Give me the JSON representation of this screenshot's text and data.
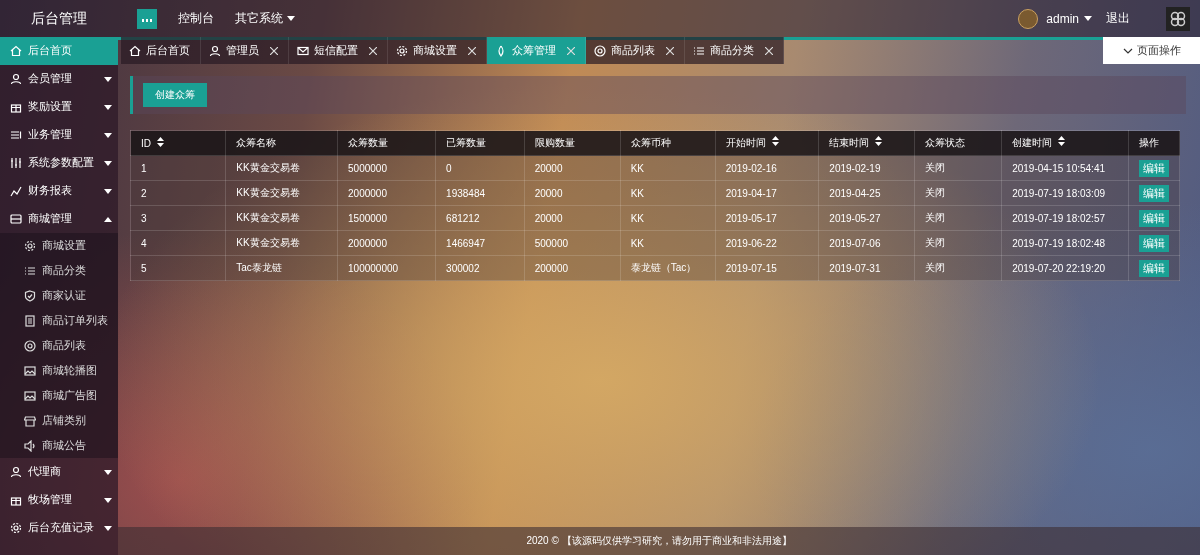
{
  "header": {
    "title": "后台管理",
    "nav": [
      {
        "label": "控制台",
        "dropdown": false
      },
      {
        "label": "其它系统",
        "dropdown": true
      }
    ],
    "user": "admin",
    "logout": "退出"
  },
  "sidebar": {
    "items": [
      {
        "label": "后台首页",
        "selected": true,
        "expanded": false
      },
      {
        "label": "会员管理",
        "selected": false,
        "expanded": false
      },
      {
        "label": "奖励设置",
        "selected": false,
        "expanded": false
      },
      {
        "label": "业务管理",
        "selected": false,
        "expanded": false
      },
      {
        "label": "系统参数配置",
        "selected": false,
        "expanded": false
      },
      {
        "label": "财务报表",
        "selected": false,
        "expanded": false
      },
      {
        "label": "商城管理",
        "selected": false,
        "expanded": true,
        "children": [
          {
            "label": "商城设置",
            "selected": false
          },
          {
            "label": "商品分类",
            "selected": false
          },
          {
            "label": "商家认证",
            "selected": false
          },
          {
            "label": "商品订单列表",
            "selected": false
          },
          {
            "label": "商品列表",
            "selected": false
          },
          {
            "label": "商城轮播图",
            "selected": false
          },
          {
            "label": "商城广告图",
            "selected": false
          },
          {
            "label": "店铺类别",
            "selected": false
          },
          {
            "label": "商城公告",
            "selected": false
          }
        ]
      },
      {
        "label": "代理商",
        "selected": false,
        "expanded": false
      },
      {
        "label": "牧场管理",
        "selected": false,
        "expanded": false
      },
      {
        "label": "后台充值记录",
        "selected": false,
        "expanded": false
      }
    ]
  },
  "tabs": [
    {
      "label": "后台首页",
      "selected": false,
      "closable": false
    },
    {
      "label": "管理员",
      "selected": false,
      "closable": true
    },
    {
      "label": "短信配置",
      "selected": false,
      "closable": true
    },
    {
      "label": "商城设置",
      "selected": false,
      "closable": true
    },
    {
      "label": "众筹管理",
      "selected": true,
      "closable": true
    },
    {
      "label": "商品列表",
      "selected": false,
      "closable": true
    },
    {
      "label": "商品分类",
      "selected": false,
      "closable": true
    }
  ],
  "page_actions": "页面操作",
  "create_button": "创建众筹",
  "table": {
    "columns": [
      {
        "label": "ID",
        "sortable": true
      },
      {
        "label": "众筹名称",
        "sortable": false
      },
      {
        "label": "众筹数量",
        "sortable": false
      },
      {
        "label": "已筹数量",
        "sortable": false
      },
      {
        "label": "限购数量",
        "sortable": false
      },
      {
        "label": "众筹币种",
        "sortable": false
      },
      {
        "label": "开始时间",
        "sortable": true
      },
      {
        "label": "结束时间",
        "sortable": true
      },
      {
        "label": "众筹状态",
        "sortable": false
      },
      {
        "label": "创建时间",
        "sortable": true
      },
      {
        "label": "操作",
        "sortable": false
      }
    ],
    "rows": [
      {
        "cells": [
          "1",
          "KK黄金交易卷",
          "5000000",
          "0",
          "20000",
          "KK",
          "2019-02-16",
          "2019-02-19",
          "关闭",
          "2019-04-15 10:54:41"
        ],
        "action": "编辑"
      },
      {
        "cells": [
          "2",
          "KK黄金交易卷",
          "2000000",
          "1938484",
          "20000",
          "KK",
          "2019-04-17",
          "2019-04-25",
          "关闭",
          "2019-07-19 18:03:09"
        ],
        "action": "编辑"
      },
      {
        "cells": [
          "3",
          "KK黄金交易卷",
          "1500000",
          "681212",
          "20000",
          "KK",
          "2019-05-17",
          "2019-05-27",
          "关闭",
          "2019-07-19 18:02:57"
        ],
        "action": "编辑"
      },
      {
        "cells": [
          "4",
          "KK黄金交易卷",
          "2000000",
          "1466947",
          "500000",
          "KK",
          "2019-06-22",
          "2019-07-06",
          "关闭",
          "2019-07-19 18:02:48"
        ],
        "action": "编辑"
      },
      {
        "cells": [
          "5",
          "Tac泰龙链",
          "100000000",
          "300002",
          "200000",
          "泰龙链（Tac）",
          "2019-07-15",
          "2019-07-31",
          "关闭",
          "2019-07-20 22:19:20"
        ],
        "action": "编辑"
      }
    ]
  },
  "footer": "2020 © 【该源码仅供学习研究，请勿用于商业和非法用途】"
}
